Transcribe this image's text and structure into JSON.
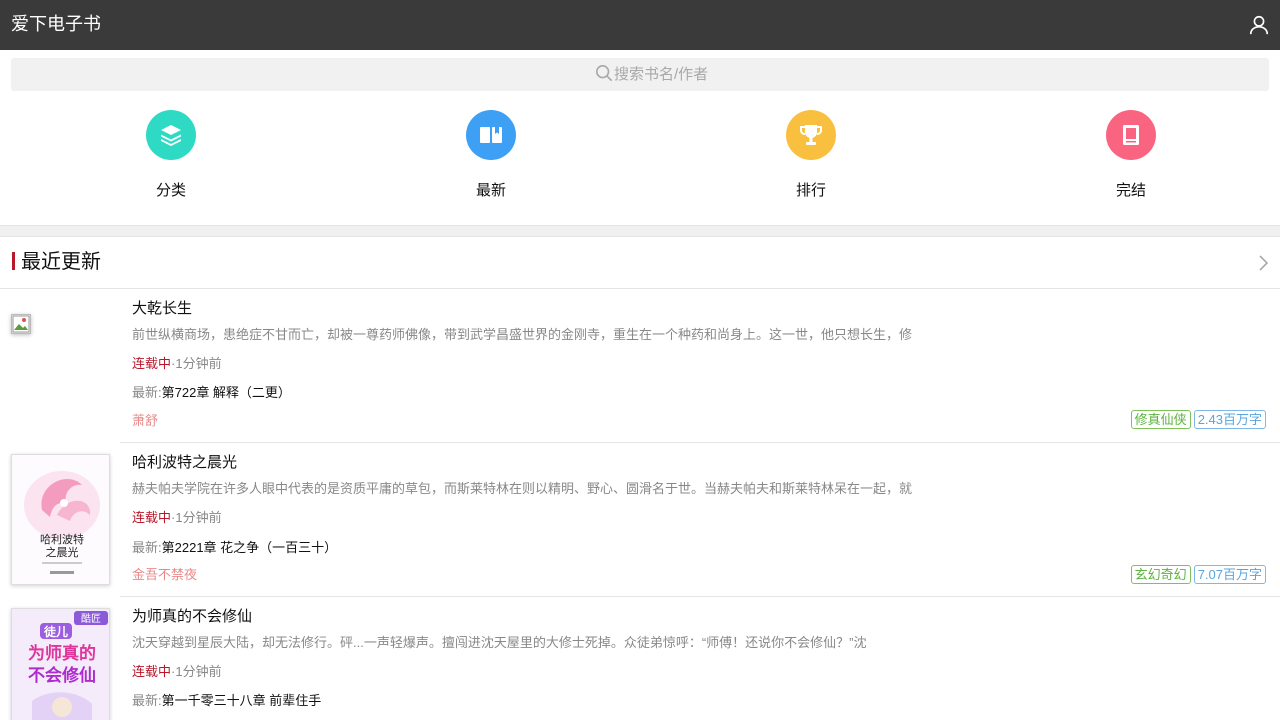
{
  "header": {
    "title": "爱下电子书",
    "user_icon": "user-icon"
  },
  "search": {
    "placeholder": "搜索书名/作者",
    "icon": "search-icon"
  },
  "nav": [
    {
      "label": "分类",
      "icon": "layers-icon",
      "color": "#2fdac4"
    },
    {
      "label": "最新",
      "icon": "book-open-icon",
      "color": "#3da0f5"
    },
    {
      "label": "排行",
      "icon": "trophy-icon",
      "color": "#f9c040"
    },
    {
      "label": "完结",
      "icon": "book-icon",
      "color": "#f96480"
    }
  ],
  "section": {
    "title": "最近更新",
    "arrow_icon": "chevron-right-icon",
    "accent": "#b8182a"
  },
  "books": [
    {
      "title": "大乾长生",
      "desc": "前世纵横商场，患绝症不甘而亡，却被一尊药师佛像，带到武学昌盛世界的金刚寺，重生在一个种药和尚身上。这一世，他只想长生，修",
      "status": "连载中",
      "time": "·1分钟前",
      "latest_prefix": "最新:",
      "latest": "第722章 解释（二更）",
      "author": "萧舒",
      "genre": "修真仙侠",
      "words": "2.43百万字"
    },
    {
      "title": "哈利波特之晨光",
      "desc": "赫夫帕夫学院在许多人眼中代表的是资质平庸的草包，而斯莱特林在则以精明、野心、圆滑名于世。当赫夫帕夫和斯莱特林呆在一起，就",
      "status": "连载中",
      "time": "·1分钟前",
      "latest_prefix": "最新:",
      "latest": "第2221章 花之争（一百三十）",
      "author": "金吾不禁夜",
      "genre": "玄幻奇幻",
      "words": "7.07百万字",
      "cover_text": [
        "哈利波特",
        "之晨光"
      ]
    },
    {
      "title": "为师真的不会修仙",
      "desc": "沈天穿越到星辰大陆，却无法修行。砰...一声轻爆声。擅闯进沈天屋里的大修士死掉。众徒弟惊呼：“师傅！还说你不会修仙？”沈",
      "status": "连载中",
      "time": "·1分钟前",
      "latest_prefix": "最新:",
      "latest": "第一千零三十八章 前辈住手",
      "cover_text": [
        "徒儿",
        "为师真的",
        "不会修仙"
      ],
      "cover_badge": "酷匠"
    }
  ]
}
